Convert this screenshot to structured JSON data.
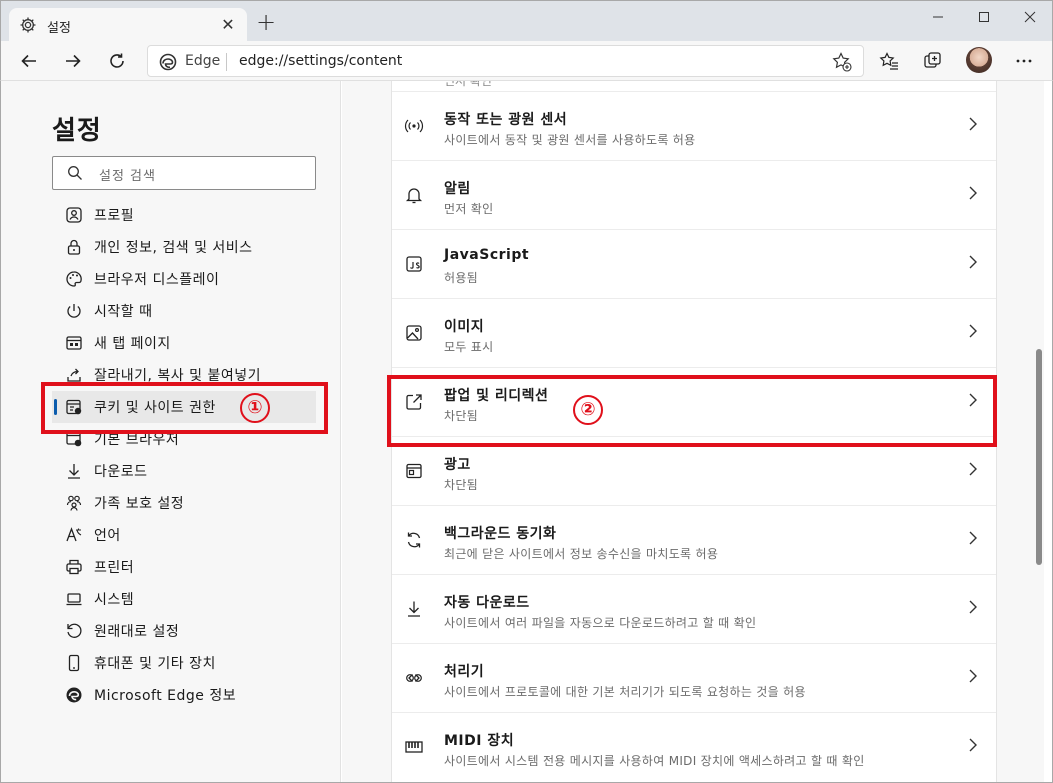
{
  "tab": {
    "title": "설정",
    "close": "✕"
  },
  "new_tab": "+",
  "address": {
    "edge_label": "Edge",
    "url": "edge://settings/content"
  },
  "sidebar": {
    "title": "설정",
    "search_placeholder": "설정 검색",
    "items": [
      {
        "label": "프로필",
        "icon": "profile-icon"
      },
      {
        "label": "개인 정보, 검색 및 서비스",
        "icon": "lock-icon"
      },
      {
        "label": "브라우저 디스플레이",
        "icon": "palette-icon"
      },
      {
        "label": "시작할 때",
        "icon": "power-icon"
      },
      {
        "label": "새 탭 페이지",
        "icon": "new-tab-page-icon"
      },
      {
        "label": "잘라내기, 복사 및 붙여넣기",
        "icon": "share-icon"
      },
      {
        "label": "쿠키 및 사이트 권한",
        "icon": "cookie-permission-icon",
        "active": true
      },
      {
        "label": "기본 브라우저",
        "icon": "default-browser-icon"
      },
      {
        "label": "다운로드",
        "icon": "download-icon"
      },
      {
        "label": "가족 보호 설정",
        "icon": "family-icon"
      },
      {
        "label": "언어",
        "icon": "language-icon"
      },
      {
        "label": "프린터",
        "icon": "printer-icon"
      },
      {
        "label": "시스템",
        "icon": "laptop-icon"
      },
      {
        "label": "원래대로 설정",
        "icon": "reset-icon"
      },
      {
        "label": "휴대폰 및 기타 장치",
        "icon": "phone-icon"
      },
      {
        "label": "Microsoft Edge 정보",
        "icon": "edge-logo-icon"
      }
    ]
  },
  "partial_top_text": "먼저 확인",
  "settings": [
    {
      "title": "동작 또는 광원 센서",
      "subtitle": "사이트에서 동작 및 광원 센서를 사용하도록 허용",
      "icon": "sensor-icon"
    },
    {
      "title": "알림",
      "subtitle": "먼저 확인",
      "icon": "bell-icon"
    },
    {
      "title": "JavaScript",
      "subtitle": "허용됨",
      "icon": "javascript-icon"
    },
    {
      "title": "이미지",
      "subtitle": "모두 표시",
      "icon": "image-icon"
    },
    {
      "title": "팝업 및 리디렉션",
      "subtitle": "차단됨",
      "icon": "popup-icon"
    },
    {
      "title": "광고",
      "subtitle": "차단됨",
      "icon": "ads-icon"
    },
    {
      "title": "백그라운드 동기화",
      "subtitle": "최근에 닫은 사이트에서 정보 송수신을 마치도록 허용",
      "icon": "sync-icon"
    },
    {
      "title": "자동 다운로드",
      "subtitle": "사이트에서 여러 파일을 자동으로 다운로드하려고 할 때 확인",
      "icon": "auto-download-icon"
    },
    {
      "title": "처리기",
      "subtitle": "사이트에서 프로토콜에 대한 기본 처리기가 되도록 요청하는 것을 허용",
      "icon": "handler-icon"
    },
    {
      "title": "MIDI 장치",
      "subtitle": "사이트에서 시스템 전용 메시지를 사용하여 MIDI 장치에 액세스하려고 할 때 확인",
      "icon": "midi-icon"
    }
  ],
  "annotations": {
    "one": "①",
    "two": "②",
    "color": "#e0101b"
  },
  "colors": {
    "accent": "#0b5cad",
    "page_bg": "#f7f7f7"
  }
}
